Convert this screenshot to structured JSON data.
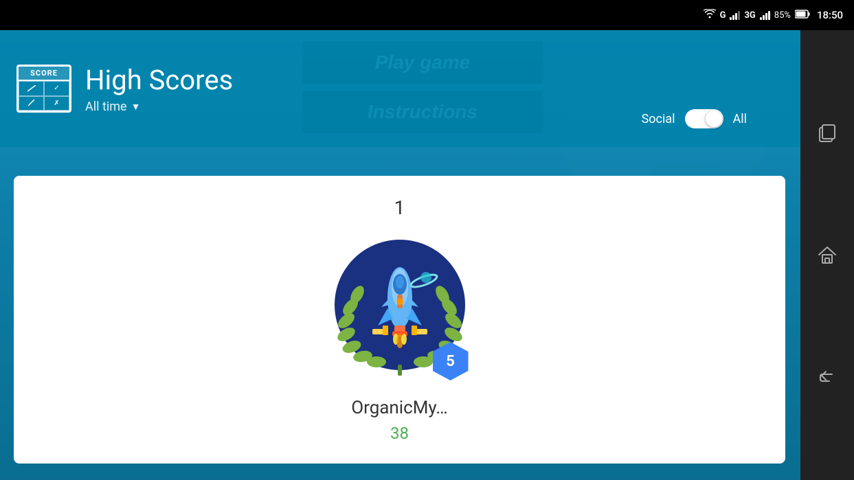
{
  "statusBar": {
    "wifi": "WiFi",
    "carrier": "G",
    "network": "3G",
    "battery": "85%",
    "time": "18:50"
  },
  "header": {
    "title": "High Scores",
    "subtitle": "All time",
    "scoreIconLabel": "SCORE"
  },
  "centerMenu": {
    "playGame": "Play game",
    "instructions": "Instructions"
  },
  "toggleArea": {
    "socialLabel": "Social",
    "allLabel": "All"
  },
  "leaderboard": {
    "rank": "1",
    "playerName": "OrganicMy…",
    "playerScore": "38",
    "levelBadge": "5"
  },
  "navIcons": {
    "copy": "⧉",
    "home": "⌂",
    "back": "↩"
  }
}
